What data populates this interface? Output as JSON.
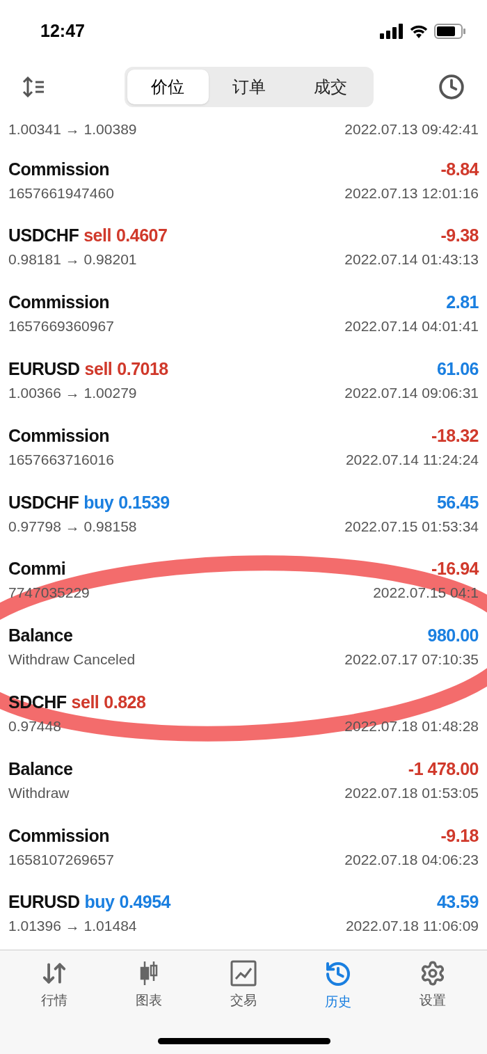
{
  "status_bar": {
    "time": "12:47"
  },
  "segments": [
    {
      "label": "价位",
      "selected": true
    },
    {
      "label": "订单",
      "selected": false
    },
    {
      "label": "成交",
      "selected": false
    }
  ],
  "rows": [
    {
      "kind": "partial",
      "detail": "1.00341 → 1.00389",
      "time": "2022.07.13 09:42:41"
    },
    {
      "kind": "entry",
      "title": "Commission",
      "amount": "-8.84",
      "color": "#d0392b",
      "detail": "1657661947460",
      "time": "2022.07.13 12:01:16"
    },
    {
      "kind": "deal",
      "title": "USDCHF",
      "side": "sell",
      "lots": "0.4607",
      "amount": "-9.38",
      "color": "#d0392b",
      "detail": "0.98181 → 0.98201",
      "time": "2022.07.14 01:43:13"
    },
    {
      "kind": "entry",
      "title": "Commission",
      "amount": "2.81",
      "color": "#1a7fe0",
      "detail": "1657669360967",
      "time": "2022.07.14 04:01:41"
    },
    {
      "kind": "deal",
      "title": "EURUSD",
      "side": "sell",
      "lots": "0.7018",
      "amount": "61.06",
      "color": "#1a7fe0",
      "detail": "1.00366 → 1.00279",
      "time": "2022.07.14 09:06:31"
    },
    {
      "kind": "entry",
      "title": "Commission",
      "amount": "-18.32",
      "color": "#d0392b",
      "detail": "1657663716016",
      "time": "2022.07.14 11:24:24"
    },
    {
      "kind": "deal",
      "title": "USDCHF",
      "side": "buy",
      "lots": "0.1539",
      "amount": "56.45",
      "color": "#1a7fe0",
      "detail": "0.97798 → 0.98158",
      "time": "2022.07.15 01:53:34"
    },
    {
      "kind": "entry",
      "title": "Commi",
      "amount": "-16.94",
      "color": "#d0392b",
      "detail": "7747035229",
      "time": "2022.07.15 04:1"
    },
    {
      "kind": "entry",
      "title": "Balance",
      "amount": "980.00",
      "color": "#1a7fe0",
      "detail": "Withdraw Canceled",
      "time": "2022.07.17 07:10:35"
    },
    {
      "kind": "deal",
      "title": "SDCHF",
      "side": "sell",
      "lots": "0.828",
      "detail": "0.97448",
      "time": "2022.07.18 01:48:28"
    },
    {
      "kind": "entry",
      "title": "Balance",
      "amount": "-1 478.00",
      "color": "#d0392b",
      "detail": "Withdraw",
      "time": "2022.07.18 01:53:05"
    },
    {
      "kind": "entry",
      "title": "Commission",
      "amount": "-9.18",
      "color": "#d0392b",
      "detail": "1658107269657",
      "time": "2022.07.18 04:06:23"
    },
    {
      "kind": "deal",
      "title": "EURUSD",
      "side": "buy",
      "lots": "0.4954",
      "amount": "43.59",
      "color": "#1a7fe0",
      "detail": "1.01396 → 1.01484",
      "time": "2022.07.18 11:06:09"
    }
  ],
  "tab_bar": [
    {
      "label": "行情",
      "kind": "arrows",
      "selected": false
    },
    {
      "label": "图表",
      "kind": "candles",
      "selected": false
    },
    {
      "label": "交易",
      "kind": "chart",
      "selected": false
    },
    {
      "label": "历史",
      "kind": "history",
      "selected": true
    },
    {
      "label": "设置",
      "kind": "gear",
      "selected": false
    }
  ]
}
